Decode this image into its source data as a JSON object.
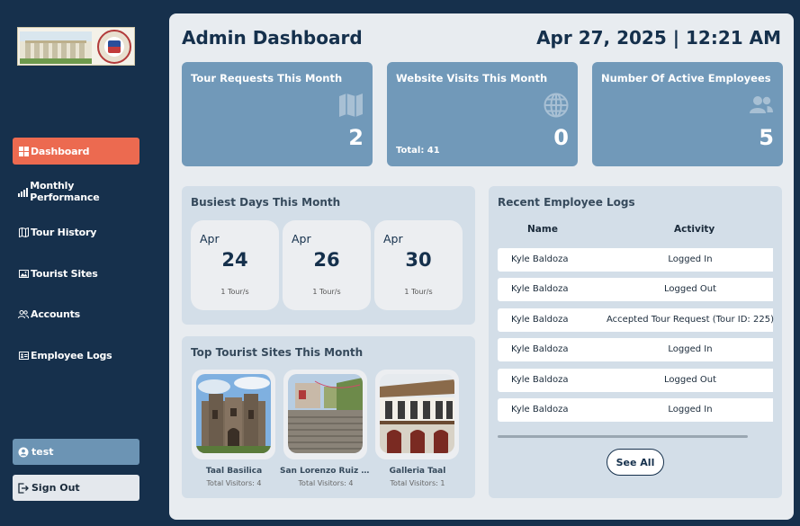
{
  "sidebar": {
    "items": [
      {
        "label": "Dashboard",
        "icon": "dashboard-icon",
        "active": true
      },
      {
        "label": "Monthly Performance",
        "icon": "bar-chart-icon"
      },
      {
        "label": "Tour History",
        "icon": "map-icon"
      },
      {
        "label": "Tourist Sites",
        "icon": "image-icon"
      },
      {
        "label": "Accounts",
        "icon": "users-icon"
      },
      {
        "label": "Employee Logs",
        "icon": "id-card-icon"
      }
    ],
    "user_label": "test",
    "signout_label": "Sign Out"
  },
  "header": {
    "title": "Admin Dashboard",
    "datetime": "Apr 27, 2025 | 12:21 AM"
  },
  "stats": [
    {
      "title": "Tour Requests This Month",
      "value": "2",
      "icon": "map-icon",
      "sub": ""
    },
    {
      "title": "Website Visits This Month",
      "value": "0",
      "icon": "globe-icon",
      "sub": "Total: 41"
    },
    {
      "title": "Number Of Active Employees",
      "value": "5",
      "icon": "users-icon",
      "sub": ""
    }
  ],
  "busiest": {
    "title": "Busiest Days This Month",
    "days": [
      {
        "month": "Apr",
        "day": "24",
        "tours": "1 Tour/s"
      },
      {
        "month": "Apr",
        "day": "26",
        "tours": "1 Tour/s"
      },
      {
        "month": "Apr",
        "day": "30",
        "tours": "1 Tour/s"
      }
    ]
  },
  "top_sites": {
    "title": "Top Tourist Sites This Month",
    "sites": [
      {
        "name": "Taal Basilica",
        "visitors": "Total Visitors: 4"
      },
      {
        "name": "San Lorenzo Ruiz Ste...",
        "visitors": "Total Visitors: 4"
      },
      {
        "name": "Galleria Taal",
        "visitors": "Total Visitors: 1"
      }
    ]
  },
  "logs": {
    "title": "Recent Employee Logs",
    "headers": {
      "name": "Name",
      "activity": "Activity"
    },
    "rows": [
      {
        "name": "Kyle Baldoza",
        "activity": "Logged In"
      },
      {
        "name": "Kyle Baldoza",
        "activity": "Logged Out"
      },
      {
        "name": "Kyle Baldoza",
        "activity": "Accepted Tour Request (Tour ID: 225)"
      },
      {
        "name": "Kyle Baldoza",
        "activity": "Logged In"
      },
      {
        "name": "Kyle Baldoza",
        "activity": "Logged Out"
      },
      {
        "name": "Kyle Baldoza",
        "activity": "Logged In"
      }
    ],
    "see_all": "See All"
  },
  "colors": {
    "sidebar_bg": "#16304c",
    "active_nav": "#ec6a50",
    "stat_card": "#7199b9",
    "panel_bg": "#d3dee8",
    "main_bg": "#e8ecf0"
  }
}
